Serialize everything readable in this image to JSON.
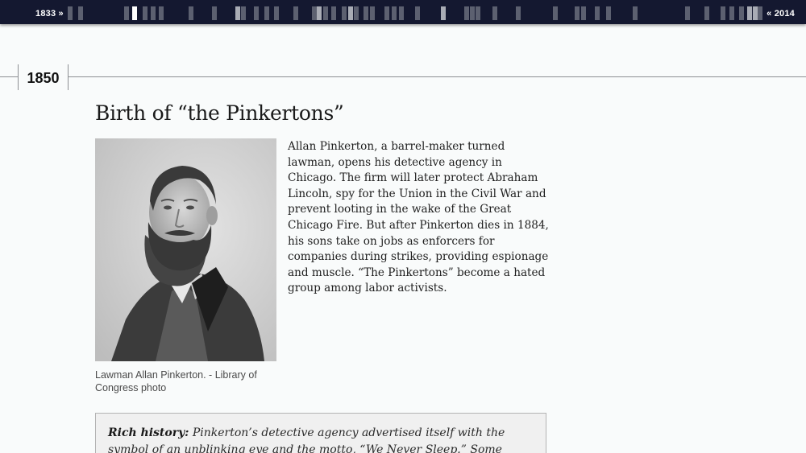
{
  "timeline": {
    "start_label": "1833 »",
    "end_label": "« 2014",
    "active_index": 3
  },
  "year": "1850",
  "article": {
    "headline": "Birth of “the Pinkertons”",
    "image_alt": "Portrait of Allan Pinkerton",
    "caption": "Lawman Allan Pinkerton. - Library of Congress photo",
    "body": "Allan Pinkerton, a barrel-maker turned lawman, opens his detective agency in Chicago. The firm will later protect Abraham Lincoln, spy for the Union in the Civil War and prevent looting in the wake of the Great Chicago Fire. But after Pinkerton dies in 1884, his sons take on jobs as enforcers for companies during strikes, providing espionage and muscle. “The Pinkertons” become a hated group among labor activists."
  },
  "callout": {
    "label": "Rich history:",
    "text": " Pinkerton’s detective agency advertised itself with the symbol of an unblinking eye and the motto, “We Never Sleep.” Some believe that’s how"
  }
}
